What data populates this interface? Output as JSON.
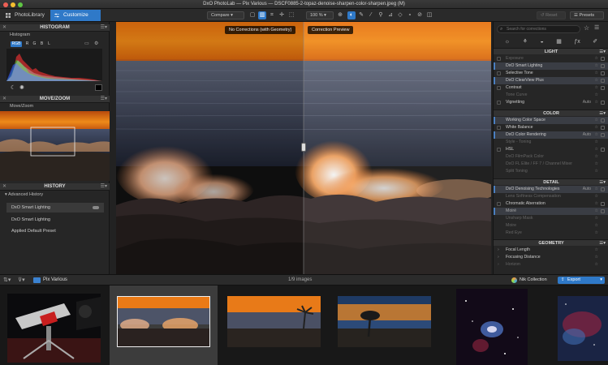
{
  "window": {
    "title": "DxO PhotoLab — Pix Various — DSCF0885-2-topaz-denoise-sharpen-color-sharpen.jpeg (M)"
  },
  "toolbar": {
    "tab_library": "PhotoLibrary",
    "tab_customize": "Customize",
    "compare_label": "Compare",
    "zoom_value": "100 %",
    "reset_label": "Reset",
    "presets_label": "Presets"
  },
  "left_panel": {
    "histogram_title": "HISTOGRAM",
    "histogram_sub": "Histogram",
    "channels": [
      "RGB",
      "R",
      "G",
      "B",
      "L"
    ],
    "movezoom_title": "MOVE/ZOOM",
    "movezoom_sub": "Move/Zoom",
    "history_title": "HISTORY",
    "history_sub": "Advanced History",
    "history_items": [
      "DxO Smart Lighting",
      "DxO Smart Lighting",
      "Applied Default Preset"
    ]
  },
  "viewer": {
    "label_left": "No Corrections (with Geometry)",
    "label_right": "Correction Preview"
  },
  "right_panel": {
    "search_placeholder": "Search for corrections",
    "sections": {
      "light": "LIGHT",
      "color": "COLOR",
      "detail": "DETAIL",
      "geometry": "GEOMETRY"
    },
    "light_items": [
      "Exposure",
      "DxO Smart Lighting",
      "Selective Tone",
      "DxO ClearView Plus",
      "Contrast",
      "Tone Curve",
      "Vignetting"
    ],
    "light_vignetting_value": "Auto",
    "color_items": [
      "Working Color Space",
      "White Balance",
      "DxO Color Rendering",
      "Style - Toning",
      "HSL",
      "DxO FilmPack Color",
      "DxO FL Elite / FF 7 / Channel Mixer",
      "Split Toning"
    ],
    "color_rendering_value": "Auto",
    "detail_items": [
      "DxO Denoising Technologies",
      "Lens Softness Compensation",
      "Chromatic Aberration",
      "Moiré",
      "Unsharp Mask",
      "Moire",
      "Red Eye"
    ],
    "denoise_value": "Auto",
    "geometry_items": [
      "Focal Length",
      "Focusing Distance",
      "Horizon"
    ]
  },
  "filmstrip": {
    "folder": "Pix Various",
    "count_label": "1/9 images",
    "nik_label": "Nik Collection",
    "export_label": "Export"
  },
  "colors": {
    "accent": "#2f79c8",
    "sunset_orange": "#e8730f",
    "panel": "#262626"
  }
}
